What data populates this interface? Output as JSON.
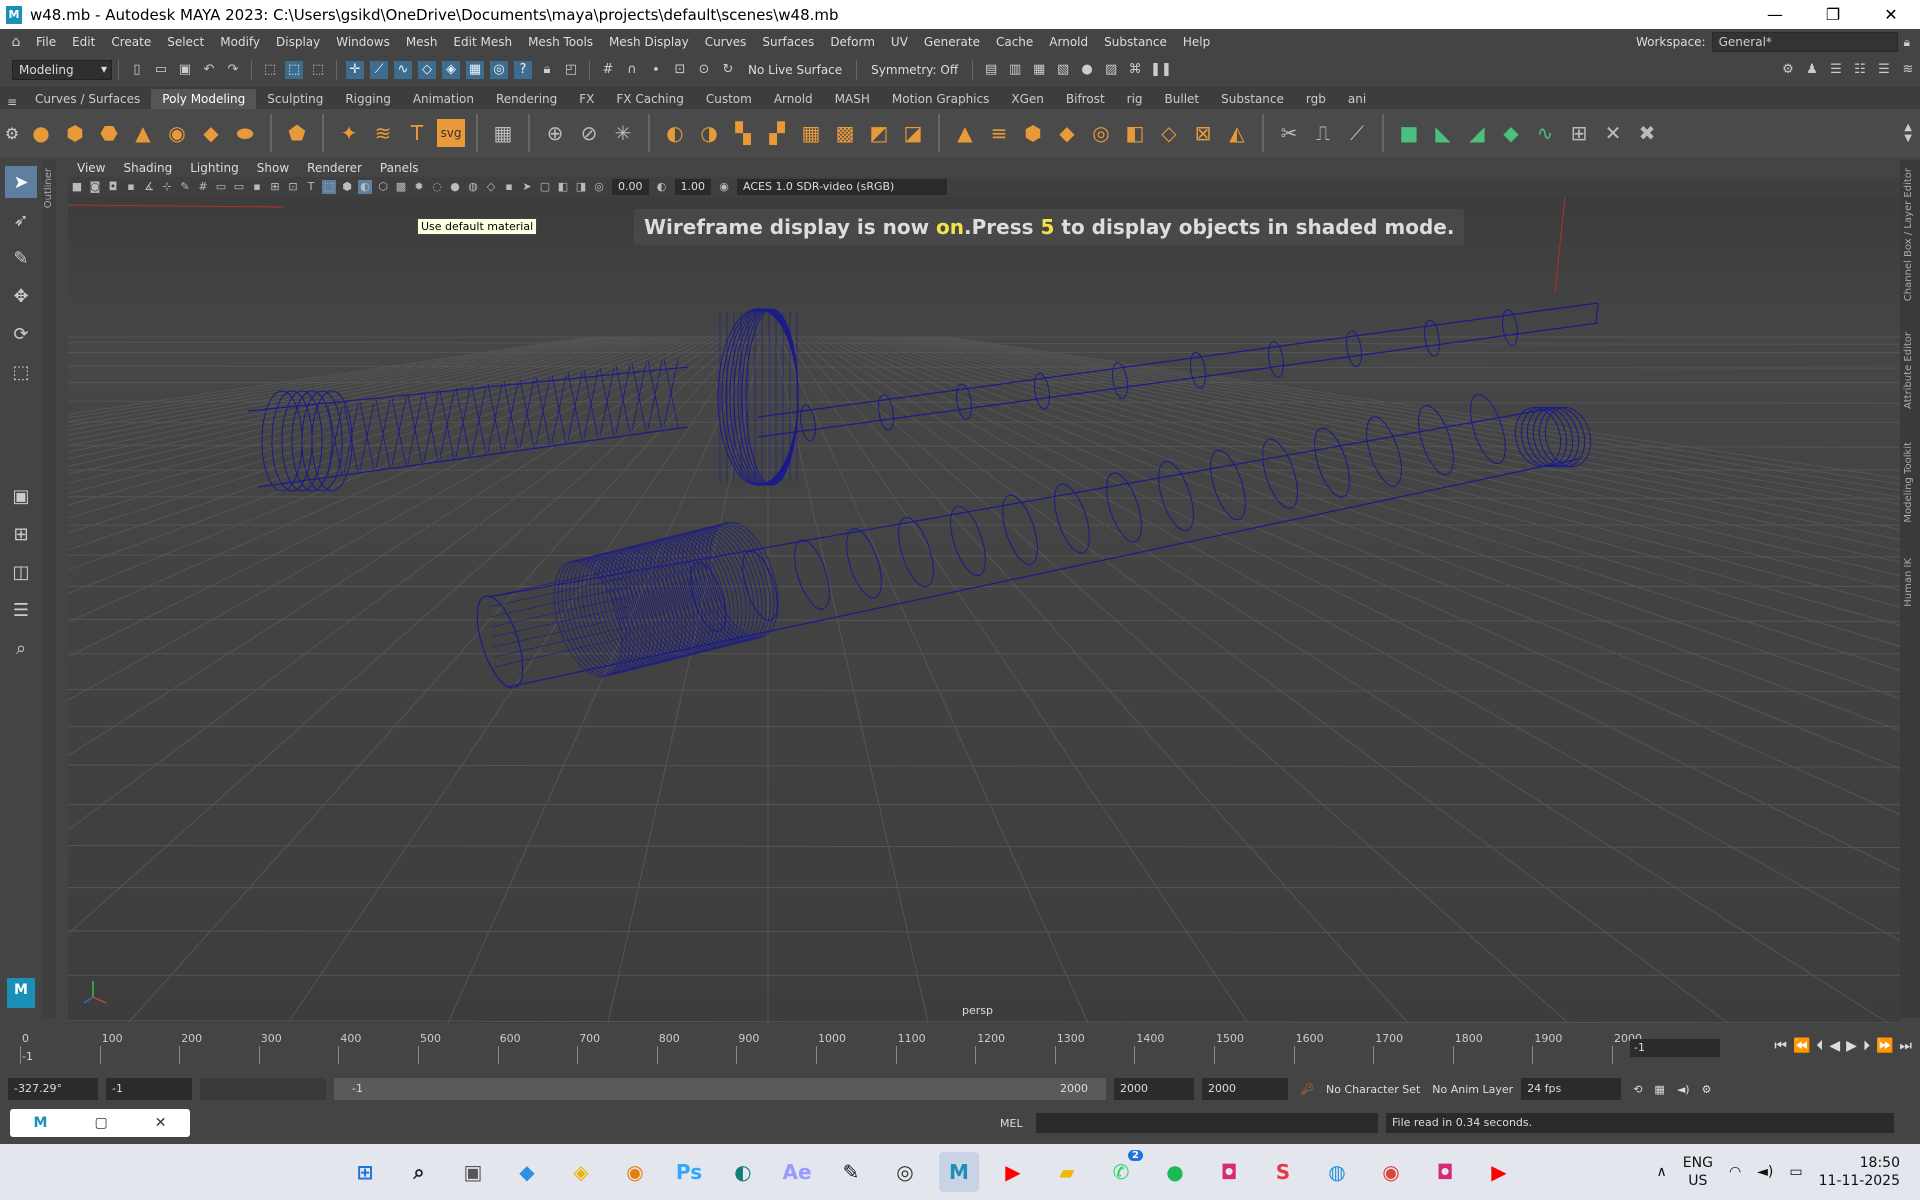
{
  "window": {
    "title": "w48.mb - Autodesk MAYA 2023: C:\\Users\\gsikd\\OneDrive\\Documents\\maya\\projects\\default\\scenes\\w48.mb",
    "minimize": "—",
    "maximize": "❐",
    "close": "✕"
  },
  "menu": [
    "File",
    "Edit",
    "Create",
    "Select",
    "Modify",
    "Display",
    "Windows",
    "Mesh",
    "Edit Mesh",
    "Mesh Tools",
    "Mesh Display",
    "Curves",
    "Surfaces",
    "Deform",
    "UV",
    "Generate",
    "Cache",
    "Arnold",
    "Substance",
    "Help"
  ],
  "workspace": {
    "label": "Workspace:",
    "value": "General*"
  },
  "statusline": {
    "mode": "Modeling",
    "live_surface": "No Live Surface",
    "symmetry": "Symmetry: Off"
  },
  "shelf_tabs": [
    "Curves / Surfaces",
    "Poly Modeling",
    "Sculpting",
    "Rigging",
    "Animation",
    "Rendering",
    "FX",
    "FX Caching",
    "Custom",
    "Arnold",
    "MASH",
    "Motion Graphics",
    "XGen",
    "Bifrost",
    "rig",
    "Bullet",
    "Substance",
    "rgb",
    "ani"
  ],
  "shelf_active_tab": "Poly Modeling",
  "panel_menu": [
    "View",
    "Shading",
    "Lighting",
    "Show",
    "Renderer",
    "Panels"
  ],
  "panel_tools": {
    "exposure": "0.00",
    "gamma": "1.00",
    "color_space": "ACES 1.0 SDR-video (sRGB)"
  },
  "tooltip": "Use default material",
  "hud": {
    "part1": "Wireframe display is now ",
    "on": "on",
    "part2": ".Press ",
    "key": "5",
    "part3": " to display objects in shaded mode."
  },
  "camera": "persp",
  "outliner_label": "Outliner",
  "right_tabs": [
    "Channel Box / Layer Editor",
    "Attribute Editor",
    "Modeling Toolkit",
    "Human IK"
  ],
  "timeline": {
    "ticks": [
      "0",
      "100",
      "200",
      "300",
      "400",
      "500",
      "600",
      "700",
      "800",
      "900",
      "1000",
      "1100",
      "1200",
      "1300",
      "1400",
      "1500",
      "1600",
      "1700",
      "1800",
      "1900",
      "2000"
    ],
    "current_marker": "-1",
    "current_frame": "-1"
  },
  "range": {
    "rotation": "-327.29°",
    "start": "-1",
    "inner_start": "-1",
    "inner_end": "2000",
    "end": "2000",
    "end2": "2000",
    "character_set": "No Character Set",
    "anim_layer": "No Anim Layer",
    "fps": "24 fps"
  },
  "cmdline": {
    "mel": "MEL",
    "result": "File read in  0.34 seconds."
  },
  "taskbar": {
    "apps": [
      {
        "name": "windows-start-icon",
        "glyph": "⊞",
        "color": "#1e74d9"
      },
      {
        "name": "search-icon",
        "glyph": "⌕",
        "color": "#222"
      },
      {
        "name": "task-view-icon",
        "glyph": "▣",
        "color": "#555"
      },
      {
        "name": "copilot-icon",
        "glyph": "◆",
        "color": "#2f8fe0"
      },
      {
        "name": "sticky-notes-icon",
        "glyph": "◈",
        "color": "#e7b400"
      },
      {
        "name": "blender-icon",
        "glyph": "◉",
        "color": "#e87d0d"
      },
      {
        "name": "photoshop-icon",
        "glyph": "Ps",
        "color": "#31a8ff"
      },
      {
        "name": "edge-icon",
        "glyph": "◐",
        "color": "#0f7d7a"
      },
      {
        "name": "after-effects-icon",
        "glyph": "Ae",
        "color": "#9999ff"
      },
      {
        "name": "inkscape-icon",
        "glyph": "✎",
        "color": "#111"
      },
      {
        "name": "obs-icon",
        "glyph": "◎",
        "color": "#333"
      },
      {
        "name": "maya-icon",
        "glyph": "M",
        "color": "#1a8fb8"
      },
      {
        "name": "youtube-icon",
        "glyph": "▶",
        "color": "#ff0000"
      },
      {
        "name": "file-explorer-icon",
        "glyph": "▰",
        "color": "#f2b705"
      },
      {
        "name": "whatsapp-icon",
        "glyph": "✆",
        "color": "#25d366"
      },
      {
        "name": "spotify-icon",
        "glyph": "●",
        "color": "#1db954"
      },
      {
        "name": "instagram-icon",
        "glyph": "◘",
        "color": "#d62976"
      },
      {
        "name": "substance-icon",
        "glyph": "S",
        "color": "#e63946"
      },
      {
        "name": "signal-icon",
        "glyph": "◍",
        "color": "#1d8fe1"
      },
      {
        "name": "chrome-icon",
        "glyph": "◉",
        "color": "#db4437"
      },
      {
        "name": "instagram-2-icon",
        "glyph": "◘",
        "color": "#d62976"
      },
      {
        "name": "youtube-2-icon",
        "glyph": "▶",
        "color": "#ff0000"
      }
    ],
    "whatsapp_badge": "2",
    "lang1": "ENG",
    "lang2": "US",
    "time": "18:50",
    "date": "11-11-2025"
  },
  "colors": {
    "wire": "#1a1a8c",
    "grid": "#555555",
    "axis_red": "#b03030"
  }
}
